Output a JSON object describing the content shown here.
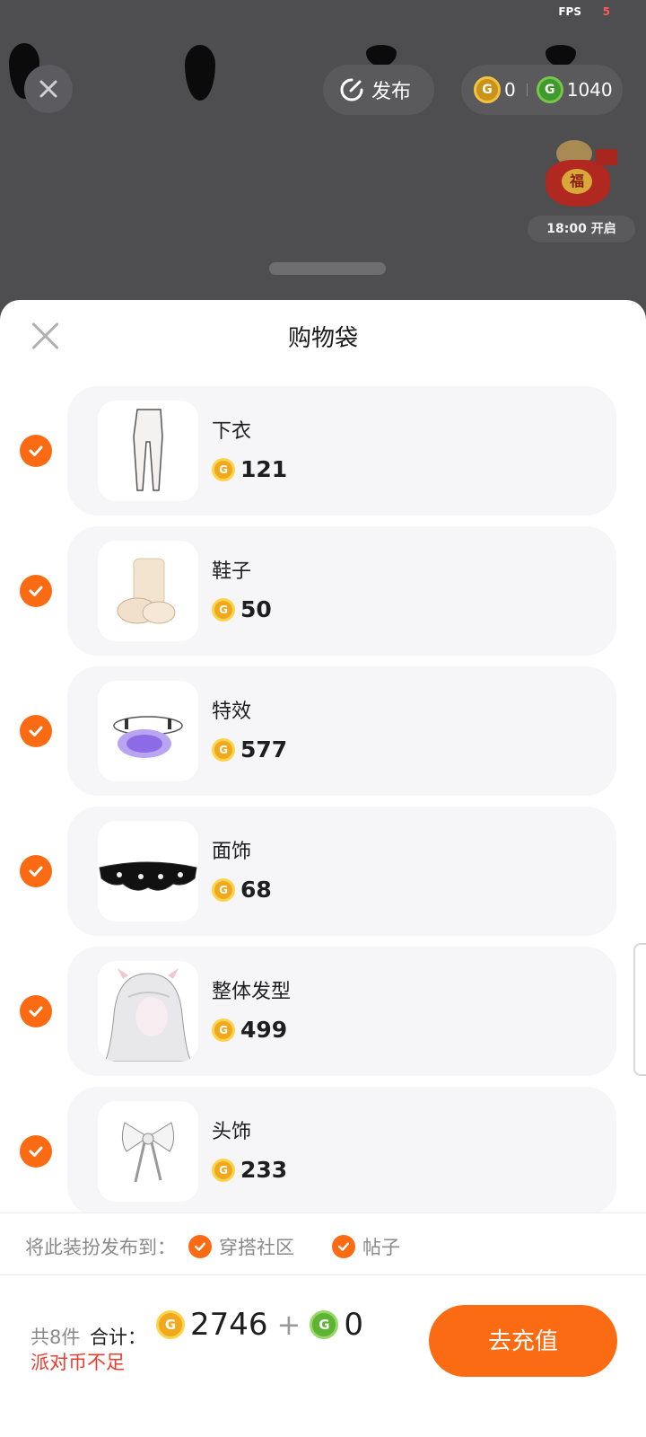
{
  "debug": {
    "fps_label": "FPS",
    "fps_value": "5"
  },
  "top_bar": {
    "publish_label": "发布",
    "gold_coins": "0",
    "green_coins": "1040"
  },
  "event": {
    "timer_text": "18:00 开启",
    "bag_glyph": "福"
  },
  "sheet": {
    "title": "购物袋",
    "items": [
      {
        "name": "下衣",
        "price": "121",
        "icon": "leggings-image"
      },
      {
        "name": "鞋子",
        "price": "50",
        "icon": "socks-shoes-image"
      },
      {
        "name": "特效",
        "price": "577",
        "icon": "magic-circle-effect-image"
      },
      {
        "name": "面饰",
        "price": "68",
        "icon": "lace-mask-image"
      },
      {
        "name": "整体发型",
        "price": "499",
        "icon": "white-hair-image"
      },
      {
        "name": "头饰",
        "price": "233",
        "icon": "white-bow-image"
      }
    ],
    "publish_to_label": "将此装扮发布到：",
    "publish_options": [
      {
        "label": "穿搭社区",
        "checked": true
      },
      {
        "label": "帖子",
        "checked": true
      }
    ]
  },
  "footer": {
    "count_label": "共8件",
    "total_label": "合计：",
    "total_gold": "2746",
    "plus": "+",
    "total_green": "0",
    "warning": "派对币不足",
    "recharge_label": "去充值"
  },
  "colors": {
    "accent": "#fb6b13",
    "warning": "#ee3a2f",
    "gold_coin": "#f2a81c",
    "green_coin": "#5db332"
  }
}
